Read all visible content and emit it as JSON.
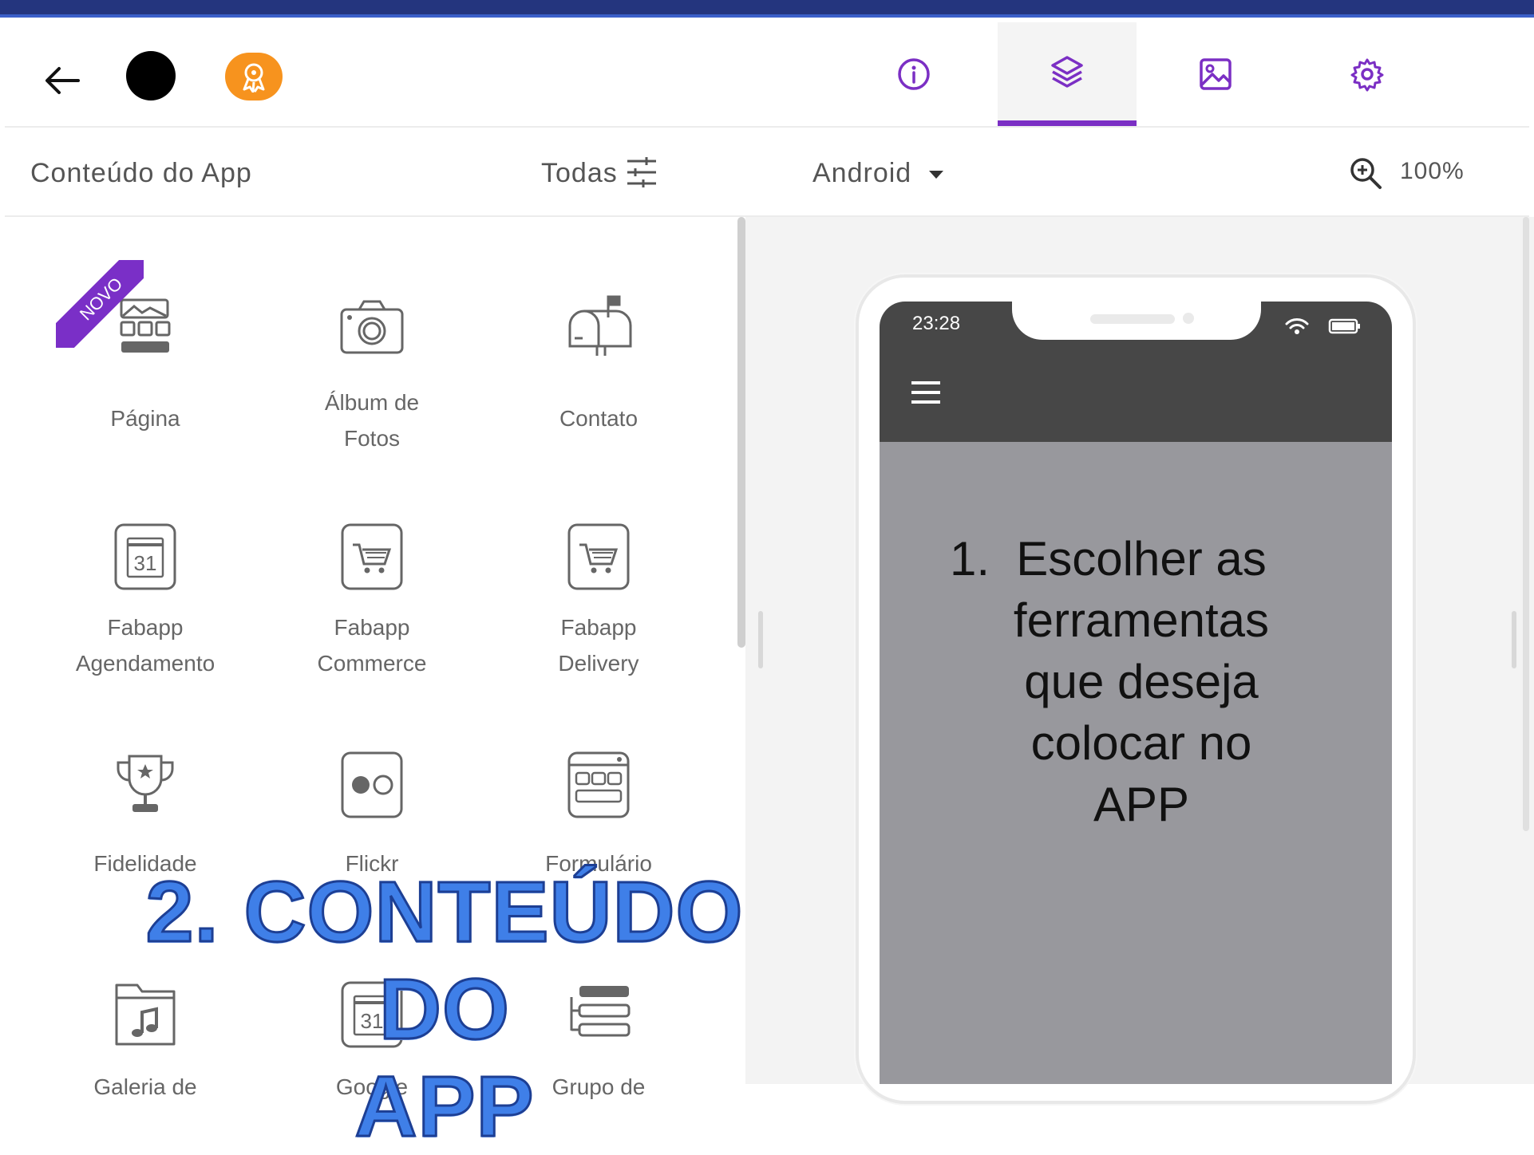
{
  "header": {
    "tabs": [
      {
        "name": "info",
        "active": false
      },
      {
        "name": "layers",
        "active": true
      },
      {
        "name": "image",
        "active": false
      },
      {
        "name": "settings",
        "active": false
      }
    ],
    "accent": "#7b2fc4"
  },
  "toolbar": {
    "title": "Conteúdo do App",
    "filter_label": "Todas",
    "platform_label": "Android",
    "zoom_label": "100%"
  },
  "items": [
    {
      "label": "Página",
      "icon": "page-layout-icon",
      "badge": "NOVO"
    },
    {
      "label": "Álbum de\nFotos",
      "icon": "camera-icon"
    },
    {
      "label": "Contato",
      "icon": "mailbox-icon"
    },
    {
      "label": "Fabapp\nAgendamento",
      "icon": "calendar-icon",
      "icon_text": "31"
    },
    {
      "label": "Fabapp\nCommerce",
      "icon": "cart-icon"
    },
    {
      "label": "Fabapp\nDelivery",
      "icon": "cart-icon"
    },
    {
      "label": "Fidelidade",
      "icon": "trophy-icon"
    },
    {
      "label": "Flickr",
      "icon": "flickr-icon"
    },
    {
      "label": "Formulário",
      "icon": "form-icon"
    },
    {
      "label": "Galeria de",
      "icon": "music-folder-icon"
    },
    {
      "label": "Google",
      "icon": "calendar-icon",
      "icon_text": "31"
    },
    {
      "label": "Grupo de",
      "icon": "list-icon"
    }
  ],
  "phone": {
    "time": "23:28",
    "instruction_number": "1.",
    "instruction_text": "Escolher as ferramentas que deseja colocar no APP"
  },
  "overlay": {
    "title_line1": "2. CONTEÚDO DO",
    "title_line2": "APP"
  }
}
